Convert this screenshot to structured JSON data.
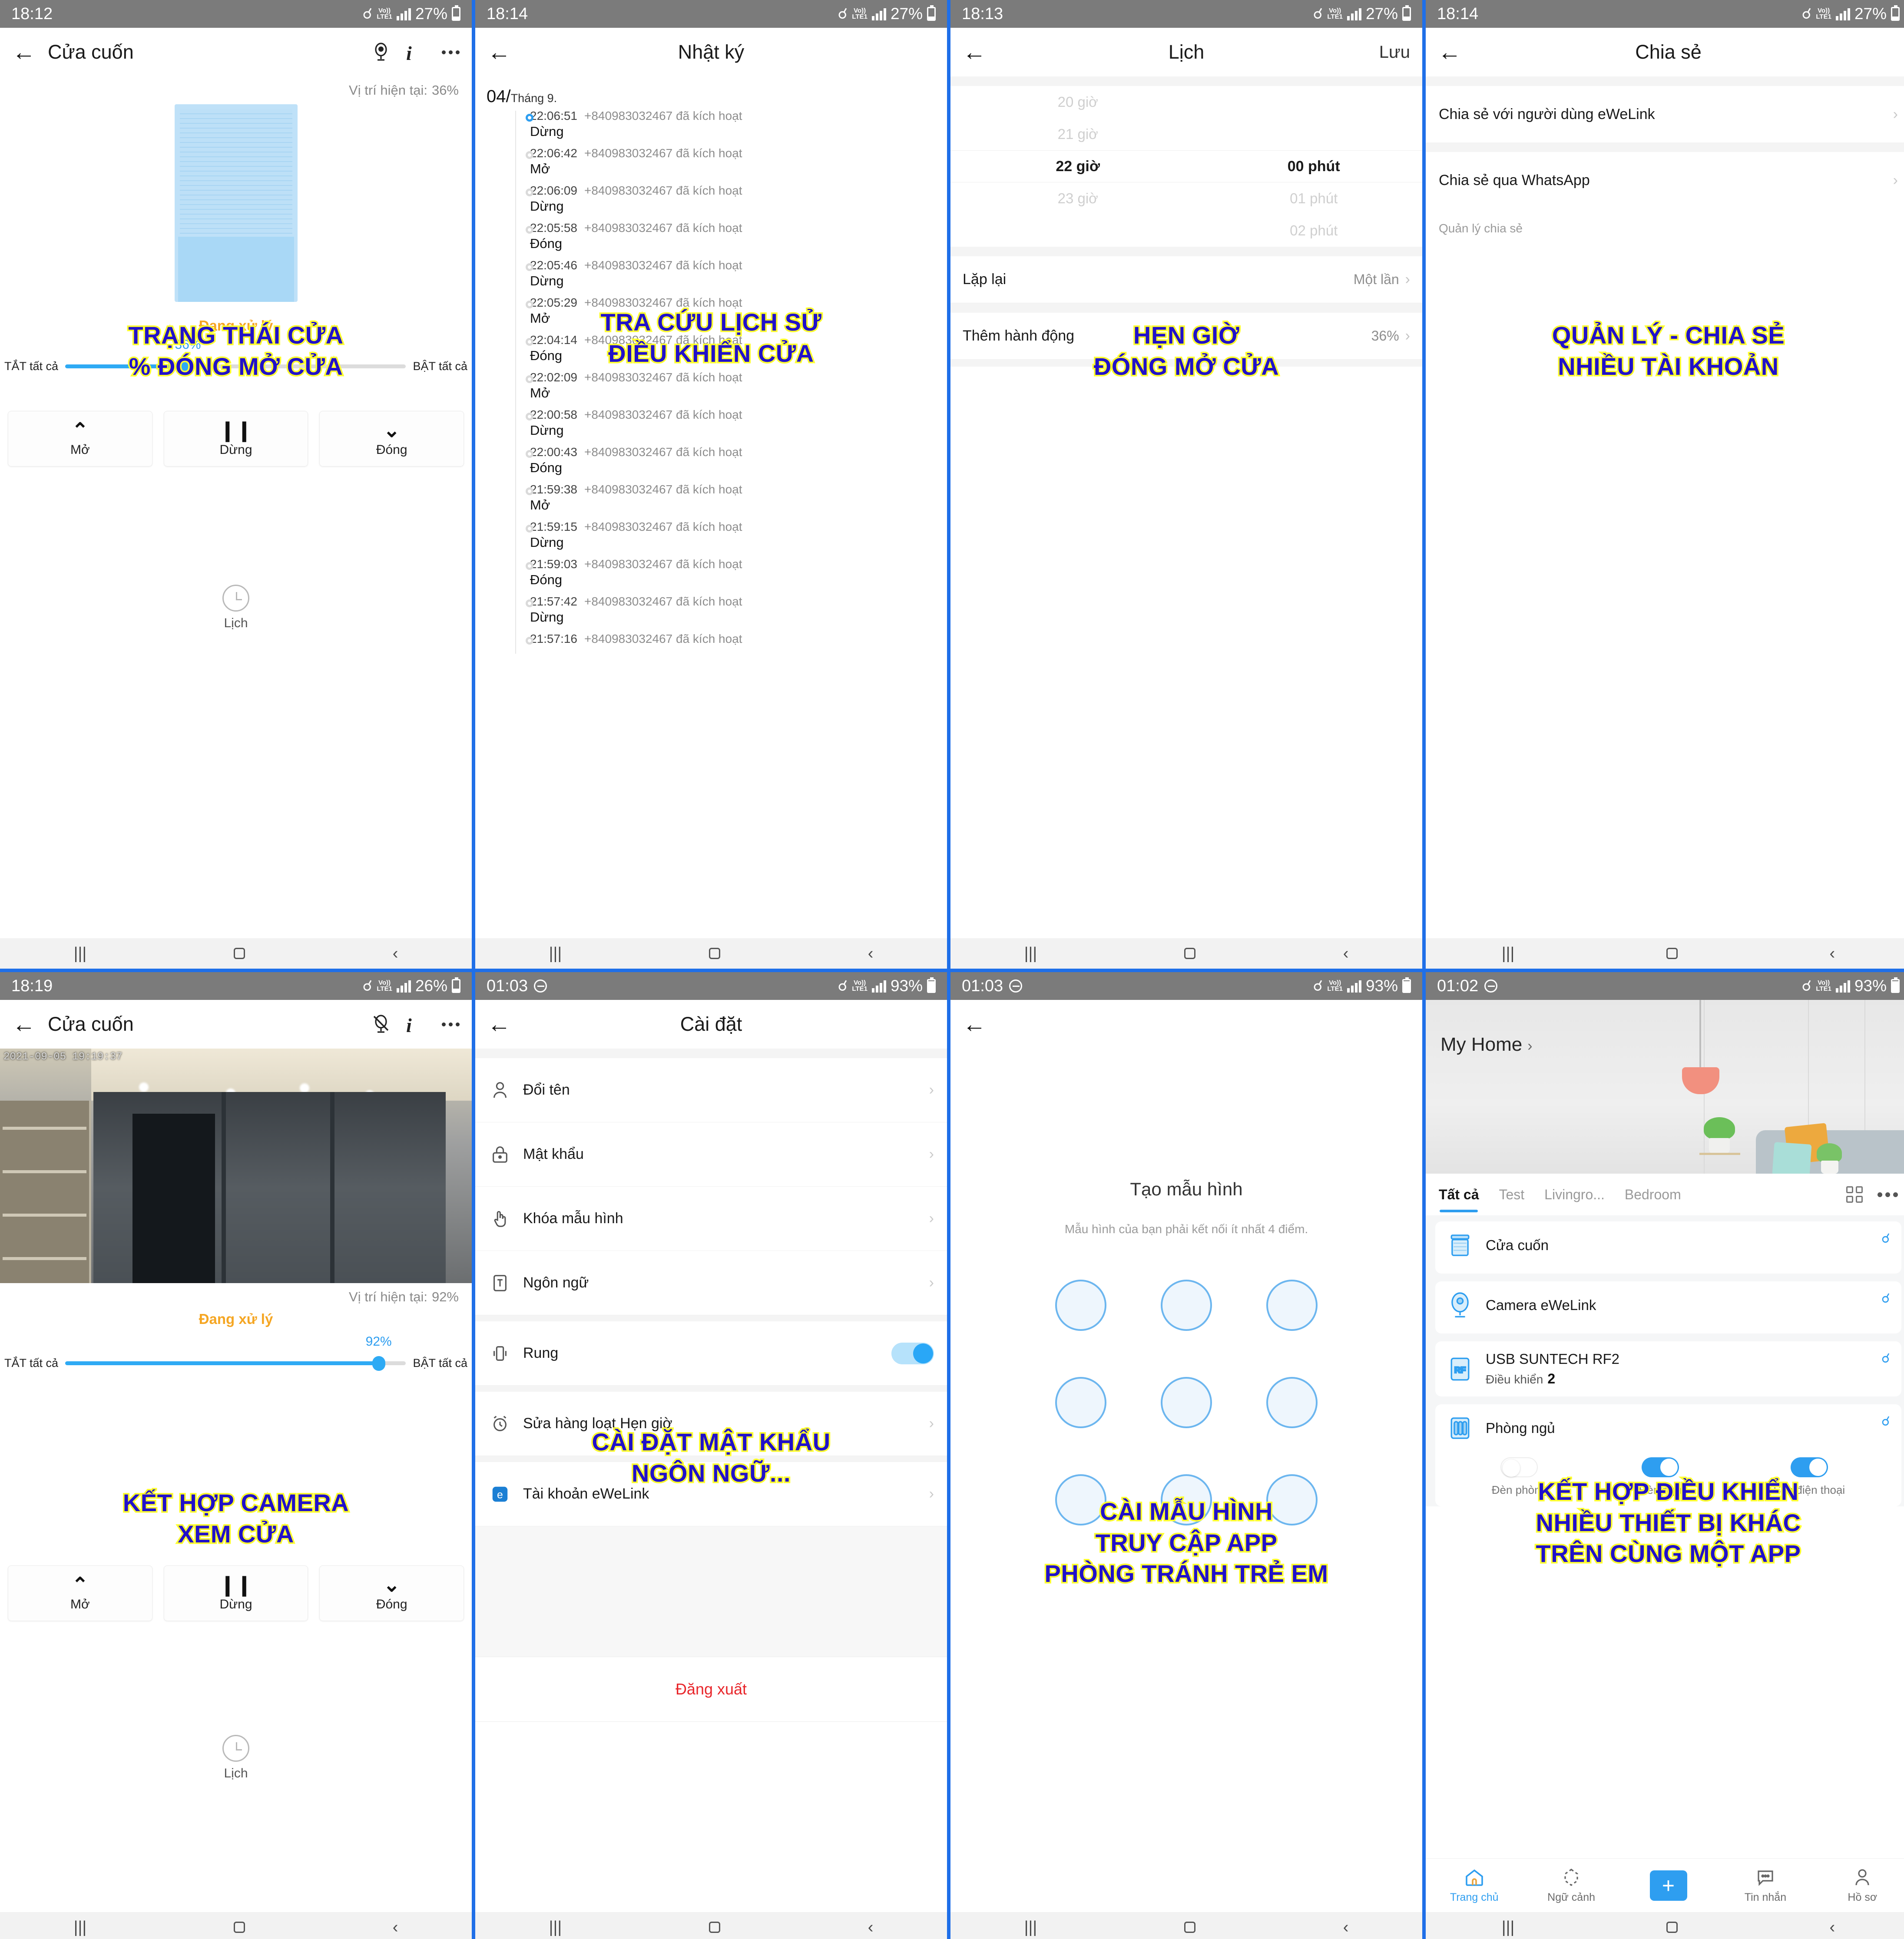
{
  "panels": {
    "cover": {
      "status": {
        "time": "18:12",
        "network": "LTE1",
        "volte": "Vo)",
        "battery": "27%"
      },
      "title": "Cửa cuốn",
      "position_label": "Vị trí hiện tại:",
      "position_value": "36%",
      "state_text": "Đang xử lý",
      "slider": {
        "value": "36%",
        "percent": 36,
        "left_label": "TẮT tất cả",
        "right_label": "BẬT tất cả"
      },
      "buttons": [
        {
          "icon": "chevron-up-icon",
          "glyph": "⌃",
          "label": "Mở"
        },
        {
          "icon": "pause-icon",
          "glyph": "❙❙",
          "label": "Dừng"
        },
        {
          "icon": "chevron-down-icon",
          "glyph": "⌄",
          "label": "Đóng"
        }
      ],
      "schedule_shortcut": "Lịch",
      "annotation": [
        "TRẠNG THÁI CỬA",
        "% ĐÓNG MỞ CỬA"
      ]
    },
    "log": {
      "status": {
        "time": "18:14",
        "network": "LTE1",
        "battery": "27%"
      },
      "title": "Nhật ký",
      "date_day": "04/",
      "date_month": "Tháng 9.",
      "actor": "+840983032467 đã kích hoạt",
      "entries": [
        {
          "time": "22:06:51",
          "actor": "+840983032467 đã kích hoạt",
          "action": "Dừng"
        },
        {
          "time": "22:06:42",
          "actor": "+840983032467 đã kích hoạt",
          "action": "Mở"
        },
        {
          "time": "22:06:09",
          "actor": "+840983032467 đã kích hoạt",
          "action": "Dừng"
        },
        {
          "time": "22:05:58",
          "actor": "+840983032467 đã kích hoạt",
          "action": "Đóng"
        },
        {
          "time": "22:05:46",
          "actor": "+840983032467 đã kích hoạt",
          "action": "Dừng"
        },
        {
          "time": "22:05:29",
          "actor": "+840983032467 đã kích hoạt",
          "action": "Mở"
        },
        {
          "time": "22:04:14",
          "actor": "+840983032467 đã kích hoạt",
          "action": "Đóng"
        },
        {
          "time": "22:02:09",
          "actor": "+840983032467 đã kích hoạt",
          "action": "Mở"
        },
        {
          "time": "22:00:58",
          "actor": "+840983032467 đã kích hoạt",
          "action": "Dừng"
        },
        {
          "time": "22:00:43",
          "actor": "+840983032467 đã kích hoạt",
          "action": "Đóng"
        },
        {
          "time": "21:59:38",
          "actor": "+840983032467 đã kích hoạt",
          "action": "Mở"
        },
        {
          "time": "21:59:15",
          "actor": "+840983032467 đã kích hoạt",
          "action": "Dừng"
        },
        {
          "time": "21:59:03",
          "actor": "+840983032467 đã kích hoạt",
          "action": "Đóng"
        },
        {
          "time": "21:57:42",
          "actor": "+840983032467 đã kích hoạt",
          "action": "Dừng"
        },
        {
          "time": "21:57:16",
          "actor": "+840983032467 đã kích hoạt",
          "action": ""
        }
      ],
      "annotation": [
        "TRA CỨU LỊCH SỬ",
        "ĐIỀU KHIỂN CỬA"
      ]
    },
    "schedule": {
      "status": {
        "time": "18:13",
        "network": "LTE1",
        "battery": "27%"
      },
      "title": "Lịch",
      "save_label": "Lưu",
      "hours": [
        "20 giờ",
        "21 giờ",
        "22 giờ",
        "23 giờ"
      ],
      "minutes": [
        "",
        "",
        "00 phút",
        "01 phút",
        "02 phút"
      ],
      "selected_hour": "22 giờ",
      "selected_minute": "00 phút",
      "rows": [
        {
          "label": "Lặp lại",
          "value": "Một lần"
        },
        {
          "label": "Thêm hành động",
          "value": "36%"
        }
      ],
      "annotation": [
        "HẸN GIỜ",
        "ĐÓNG MỞ CỬA"
      ]
    },
    "share": {
      "status": {
        "time": "18:14",
        "network": "LTE1",
        "battery": "27%"
      },
      "title": "Chia sẻ",
      "rows": [
        {
          "label": "Chia sẻ với người dùng eWeLink"
        },
        {
          "label": "Chia sẻ qua WhatsApp"
        }
      ],
      "group_title": "Quản lý chia sẻ",
      "annotation": [
        "QUẢN LÝ - CHIA SẺ",
        "NHIỀU TÀI KHOẢN"
      ]
    },
    "camera": {
      "status": {
        "time": "18:19",
        "network": "LTE1",
        "battery": "26%"
      },
      "title": "Cửa cuốn",
      "video_timestamp": "2021-09-05 19:19:37",
      "position_label": "Vị trí hiện tại:",
      "position_value": "92%",
      "state_text": "Đang xử lý",
      "slider": {
        "value": "92%",
        "percent": 92,
        "left_label": "TẮT tất cả",
        "right_label": "BẬT tất cả"
      },
      "buttons": [
        {
          "icon": "chevron-up-icon",
          "glyph": "⌃",
          "label": "Mở"
        },
        {
          "icon": "pause-icon",
          "glyph": "❙❙",
          "label": "Dừng"
        },
        {
          "icon": "chevron-down-icon",
          "glyph": "⌄",
          "label": "Đóng"
        }
      ],
      "schedule_shortcut": "Lịch",
      "annotation": [
        "KẾT HỢP CAMERA",
        "XEM CỬA"
      ]
    },
    "settings": {
      "status": {
        "time": "01:03",
        "network": "LTE1",
        "battery": "93%",
        "dnd": true
      },
      "title": "Cài đặt",
      "rows": [
        {
          "icon": "person-icon",
          "label": "Đổi tên",
          "type": "link"
        },
        {
          "icon": "lock-icon",
          "label": "Mật khẩu",
          "type": "link"
        },
        {
          "icon": "hand-tap-icon",
          "label": "Khóa mẫu hình",
          "type": "link"
        },
        {
          "icon": "text-language-icon",
          "label": "Ngôn ngữ",
          "type": "link"
        },
        {
          "icon": "vibrate-icon",
          "label": "Rung",
          "type": "toggle",
          "on": true
        },
        {
          "icon": "alarm-clock-icon",
          "label": "Sửa hàng loạt Hẹn giờ",
          "type": "link"
        },
        {
          "icon": "ewelink-icon",
          "label": "Tài khoản eWeLink",
          "type": "link"
        }
      ],
      "logout_label": "Đăng xuất",
      "annotation": [
        "CÀI ĐẶT MẬT KHẨU",
        "NGÔN NGỮ..."
      ]
    },
    "pattern": {
      "status": {
        "time": "01:03",
        "network": "LTE1",
        "battery": "93%",
        "dnd": true
      },
      "title": "Tạo mẫu hình",
      "subtitle": "Mẫu hình của bạn phải kết nối ít nhất 4 điểm.",
      "dot_count": 9,
      "annotation": [
        "CÀI MẪU HÌNH",
        "TRUY CẬP APP",
        "PHÒNG TRÁNH TRẺ EM"
      ]
    },
    "home": {
      "status": {
        "time": "01:02",
        "network": "LTE1",
        "battery": "93%",
        "dnd": true
      },
      "home_name": "My Home",
      "tabs": [
        {
          "label": "Tất cả",
          "active": true
        },
        {
          "label": "Test",
          "active": false
        },
        {
          "label": "Livingro...",
          "active": false
        },
        {
          "label": "Bedroom",
          "active": false
        }
      ],
      "devices": [
        {
          "icon": "roller-door-icon",
          "name": "Cửa cuốn",
          "sub": "",
          "sub_value": "",
          "wifi": true
        },
        {
          "icon": "camera-icon",
          "name": "Camera eWeLink",
          "sub": "",
          "sub_value": "",
          "wifi": true
        },
        {
          "icon": "rf-icon",
          "name": "USB SUNTECH RF2",
          "sub": "Điều khiển",
          "sub_value": "2",
          "wifi": true
        },
        {
          "icon": "switch-panel-icon",
          "name": "Phòng ngủ",
          "sub": "",
          "sub_value": "",
          "wifi": true,
          "switches": [
            {
              "label": "Đèn phòng",
              "on": false
            },
            {
              "label": "Đèn ngủ",
              "on": true
            },
            {
              "label": "Sạc điện thoại",
              "on": true
            }
          ]
        }
      ],
      "bottom_nav": [
        {
          "icon": "home-icon",
          "label": "Trang chủ",
          "active": true
        },
        {
          "icon": "scene-icon",
          "label": "Ngữ cảnh",
          "active": false
        },
        {
          "icon": "plus-icon",
          "label": "",
          "active": false
        },
        {
          "icon": "message-icon",
          "label": "Tin nhắn",
          "active": false
        },
        {
          "icon": "profile-icon",
          "label": "Hồ sơ",
          "active": false
        }
      ],
      "annotation": [
        "KẾT HỢP ĐIỀU KHIỂN",
        "NHIỀU THIẾT BỊ KHÁC",
        "TRÊN CÙNG MỘT APP"
      ]
    }
  },
  "colors": {
    "accent": "#2e9ef0",
    "annotation_fill": "#2111c9",
    "annotation_stroke": "#ffff2e",
    "warning": "#f5a623",
    "danger": "#e8262b",
    "collage_bg": "#1f6fe8"
  }
}
